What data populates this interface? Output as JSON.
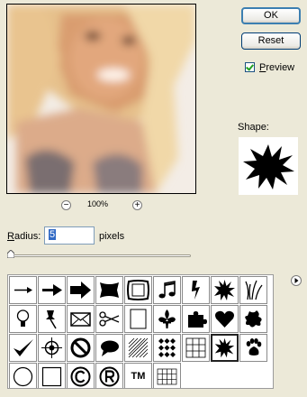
{
  "buttons": {
    "ok": "OK",
    "reset": "Reset"
  },
  "preview": {
    "label": "Preview",
    "checked": true
  },
  "shape": {
    "label": "Shape:",
    "current": "starburst-icon"
  },
  "zoom": {
    "level": "100%",
    "zoom_out": "−",
    "zoom_in": "+"
  },
  "radius": {
    "label": "Radius:",
    "value": "5",
    "unit": "pixels"
  },
  "shapes": [
    "thin-arrow-icon",
    "arrow-icon",
    "bold-arrow-icon",
    "banner-icon",
    "frame-icon",
    "music-notes-icon",
    "lightning-icon",
    "starburst-small-icon",
    "grass-icon",
    "lightbulb-icon",
    "thumbtack-icon",
    "envelope-icon",
    "scissors-icon",
    "blank-page-icon",
    "fleur-de-lis-icon",
    "puzzle-icon",
    "heart-icon",
    "splat-icon",
    "checkmark-icon",
    "target-icon",
    "no-sign-icon",
    "speech-bubble-icon",
    "hatch-pattern-icon",
    "diamond-checker-icon",
    "grid-icon",
    "starburst-icon",
    "paw-icon",
    "circle-icon",
    "square-icon",
    "copyright-icon",
    "registered-icon",
    "trademark-icon",
    "tile-grid-icon"
  ],
  "trademark_text": "TM"
}
